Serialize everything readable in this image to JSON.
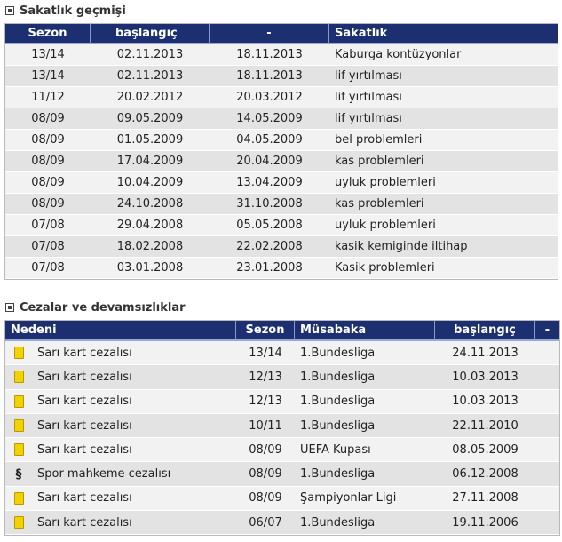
{
  "injury": {
    "title": "Sakatlık geçmişi",
    "headers": [
      "Sezon",
      "başlangıç",
      "-",
      "Sakatlık"
    ],
    "rows": [
      {
        "season": "13/14",
        "start": "02.11.2013",
        "end": "18.11.2013",
        "injury": "Kaburga kontüzyonlar"
      },
      {
        "season": "13/14",
        "start": "02.11.2013",
        "end": "18.11.2013",
        "injury": "lif yırtılması"
      },
      {
        "season": "11/12",
        "start": "20.02.2012",
        "end": "20.03.2012",
        "injury": "lif yırtılması"
      },
      {
        "season": "08/09",
        "start": "09.05.2009",
        "end": "14.05.2009",
        "injury": "lif yırtılması"
      },
      {
        "season": "08/09",
        "start": "01.05.2009",
        "end": "04.05.2009",
        "injury": "bel problemleri"
      },
      {
        "season": "08/09",
        "start": "17.04.2009",
        "end": "20.04.2009",
        "injury": "kas problemleri"
      },
      {
        "season": "08/09",
        "start": "10.04.2009",
        "end": "13.04.2009",
        "injury": "uyluk problemleri"
      },
      {
        "season": "08/09",
        "start": "24.10.2008",
        "end": "31.10.2008",
        "injury": "kas problemleri"
      },
      {
        "season": "07/08",
        "start": "29.04.2008",
        "end": "05.05.2008",
        "injury": "uyluk problemleri"
      },
      {
        "season": "07/08",
        "start": "18.02.2008",
        "end": "22.02.2008",
        "injury": "kasik kemiginde iltihap"
      },
      {
        "season": "07/08",
        "start": "03.01.2008",
        "end": "23.01.2008",
        "injury": "Kasik problemleri"
      }
    ]
  },
  "penalties": {
    "title": "Cezalar ve devamsızlıklar",
    "headers": [
      "Nedeni",
      "Sezon",
      "Müsabaka",
      "başlangıç",
      "-"
    ],
    "rows": [
      {
        "icon": "yellow-card-icon",
        "reason": "Sarı kart cezalısı",
        "season": "13/14",
        "competition": "1.Bundesliga",
        "start": "24.11.2013"
      },
      {
        "icon": "yellow-card-icon",
        "reason": "Sarı kart cezalısı",
        "season": "12/13",
        "competition": "1.Bundesliga",
        "start": "10.03.2013"
      },
      {
        "icon": "yellow-card-icon",
        "reason": "Sarı kart cezalısı",
        "season": "12/13",
        "competition": "1.Bundesliga",
        "start": "10.03.2013"
      },
      {
        "icon": "yellow-card-icon",
        "reason": "Sarı kart cezalısı",
        "season": "10/11",
        "competition": "1.Bundesliga",
        "start": "22.11.2010"
      },
      {
        "icon": "yellow-card-icon",
        "reason": "Sarı kart cezalısı",
        "season": "08/09",
        "competition": "UEFA Kupası",
        "start": "08.05.2009"
      },
      {
        "icon": "paragraph-icon",
        "symbol": "§",
        "reason": "Spor mahkeme cezalısı",
        "season": "08/09",
        "competition": "1.Bundesliga",
        "start": "06.12.2008"
      },
      {
        "icon": "yellow-card-icon",
        "reason": "Sarı kart cezalısı",
        "season": "08/09",
        "competition": "Şampiyonlar Ligi",
        "start": "27.11.2008"
      },
      {
        "icon": "yellow-card-icon",
        "reason": "Sarı kart cezalısı",
        "season": "06/07",
        "competition": "1.Bundesliga",
        "start": "19.11.2006"
      }
    ]
  },
  "colors": {
    "header_bg": "#1c2f70",
    "row_light": "#f2f2f2",
    "row_dark": "#e3e3e3",
    "yellow_card": "#f2d200"
  }
}
